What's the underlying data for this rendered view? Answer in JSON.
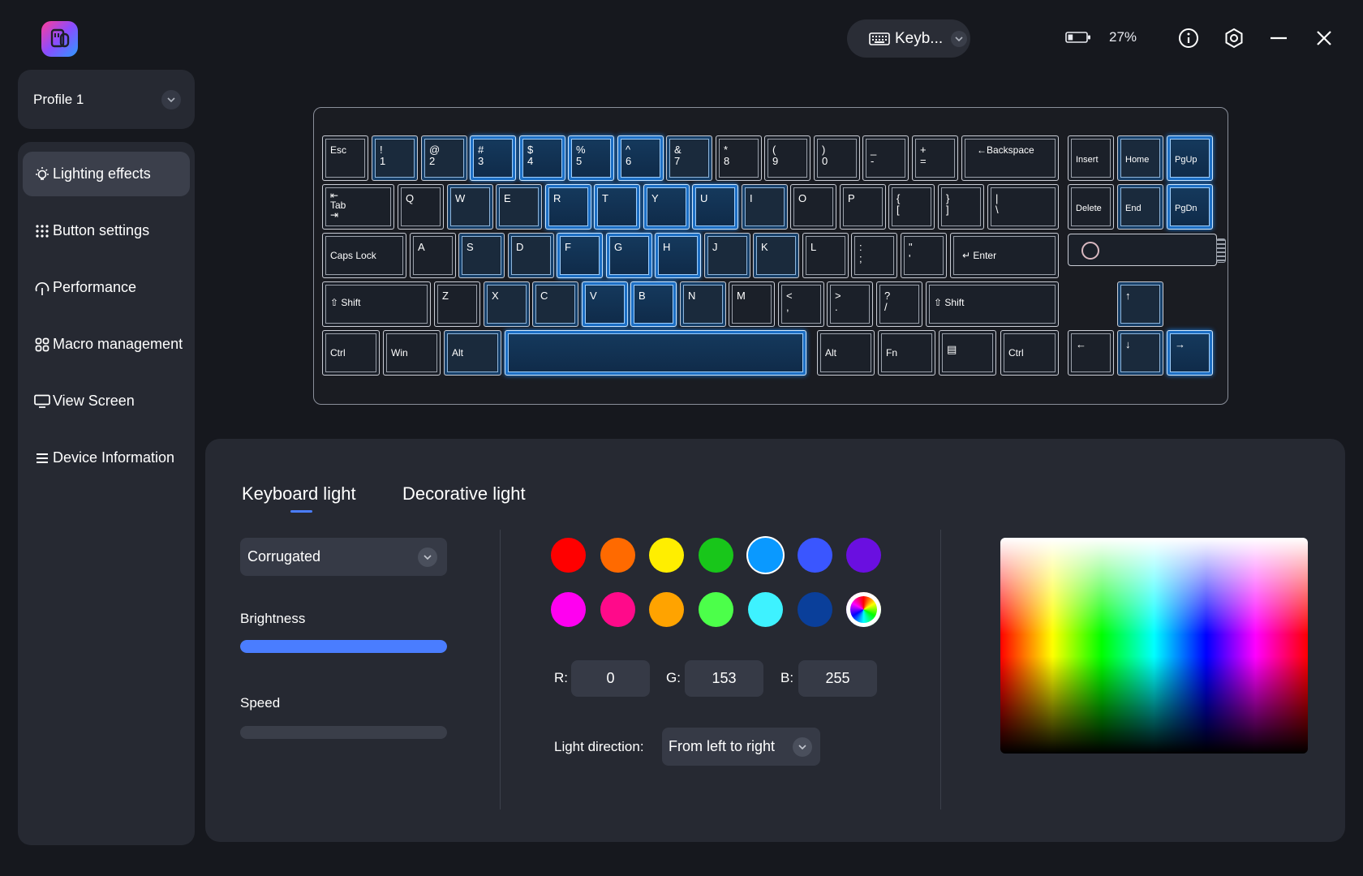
{
  "header": {
    "device_name": "Keyb...",
    "battery_percent": "27%",
    "battery_level": 0.27
  },
  "sidebar": {
    "profile": "Profile 1",
    "items": [
      {
        "label": "Lighting effects",
        "icon": "bulb-icon",
        "active": true
      },
      {
        "label": "Button settings",
        "icon": "grid-dots-icon",
        "active": false
      },
      {
        "label": "Performance",
        "icon": "gauge-icon",
        "active": false
      },
      {
        "label": "Macro management",
        "icon": "macro-icon",
        "active": false
      },
      {
        "label": "View Screen",
        "icon": "monitor-icon",
        "active": false
      },
      {
        "label": "Device Information",
        "icon": "list-icon",
        "active": false
      }
    ]
  },
  "keyboard": {
    "keys": {
      "esc": "Esc",
      "k1": "!\n1",
      "k2": "@\n2",
      "k3": "#\n3",
      "k4": "$\n4",
      "k5": "%\n5",
      "k6": "^\n6",
      "k7": "&\n7",
      "k8": "*\n8",
      "k9": "(\n9",
      "k0": ")\n0",
      "minus": "_\n-",
      "equal": "+\n=",
      "backspace": "←Backspace",
      "tab": "⇤\nTab\n⇥",
      "q": "Q",
      "w": "W",
      "e": "E",
      "r": "R",
      "t": "T",
      "y": "Y",
      "u": "U",
      "i": "I",
      "o": "O",
      "p": "P",
      "lbr": "{\n[",
      "rbr": "}\n]",
      "bslash": "|\n\\",
      "caps": "Caps Lock",
      "a": "A",
      "s": "S",
      "d": "D",
      "f": "F",
      "g": "G",
      "h": "H",
      "j": "J",
      "k": "K",
      "l": "L",
      "semi": ":\n;",
      "quote": "\"\n'",
      "enter": "↵ Enter",
      "lshift": "⇧ Shift",
      "z": "Z",
      "x": "X",
      "c": "C",
      "v": "V",
      "b": "B",
      "n": "N",
      "m": "M",
      "comma": "<\n,",
      "period": ">\n.",
      "slash": "?\n/",
      "rshift": "⇧ Shift",
      "lctrl": "Ctrl",
      "win": "Win",
      "lalt": "Alt",
      "space": "",
      "ralt": "Alt",
      "fn": "Fn",
      "menu": "▤",
      "rctrl": "Ctrl",
      "insert": "Insert",
      "home": "Home",
      "pgup": "PgUp",
      "delete": "Delete",
      "end": "End",
      "pgdn": "PgDn",
      "up": "↑",
      "left": "←",
      "down": "↓",
      "right": "→"
    }
  },
  "panel": {
    "tabs": [
      {
        "label": "Keyboard light",
        "active": true
      },
      {
        "label": "Decorative light",
        "active": false
      }
    ],
    "effect": "Corrugated",
    "brightness_label": "Brightness",
    "brightness_value": 1.0,
    "speed_label": "Speed",
    "speed_value": 0.0,
    "swatches": [
      "#ff0000",
      "#ff6a00",
      "#ffee00",
      "#18c61a",
      "#0a99ff",
      "#3a56ff",
      "#6a0fe0",
      "#ff00f0",
      "#ff0a8a",
      "#ffa300",
      "#4cff4a",
      "#3ef2ff",
      "#0a3f9a",
      "rainbow"
    ],
    "selected_swatch": 4,
    "r_label": "R:",
    "g_label": "G:",
    "b_label": "B:",
    "r_value": "0",
    "g_value": "153",
    "b_value": "255",
    "direction_label": "Light direction:",
    "direction_value": "From left to right"
  }
}
